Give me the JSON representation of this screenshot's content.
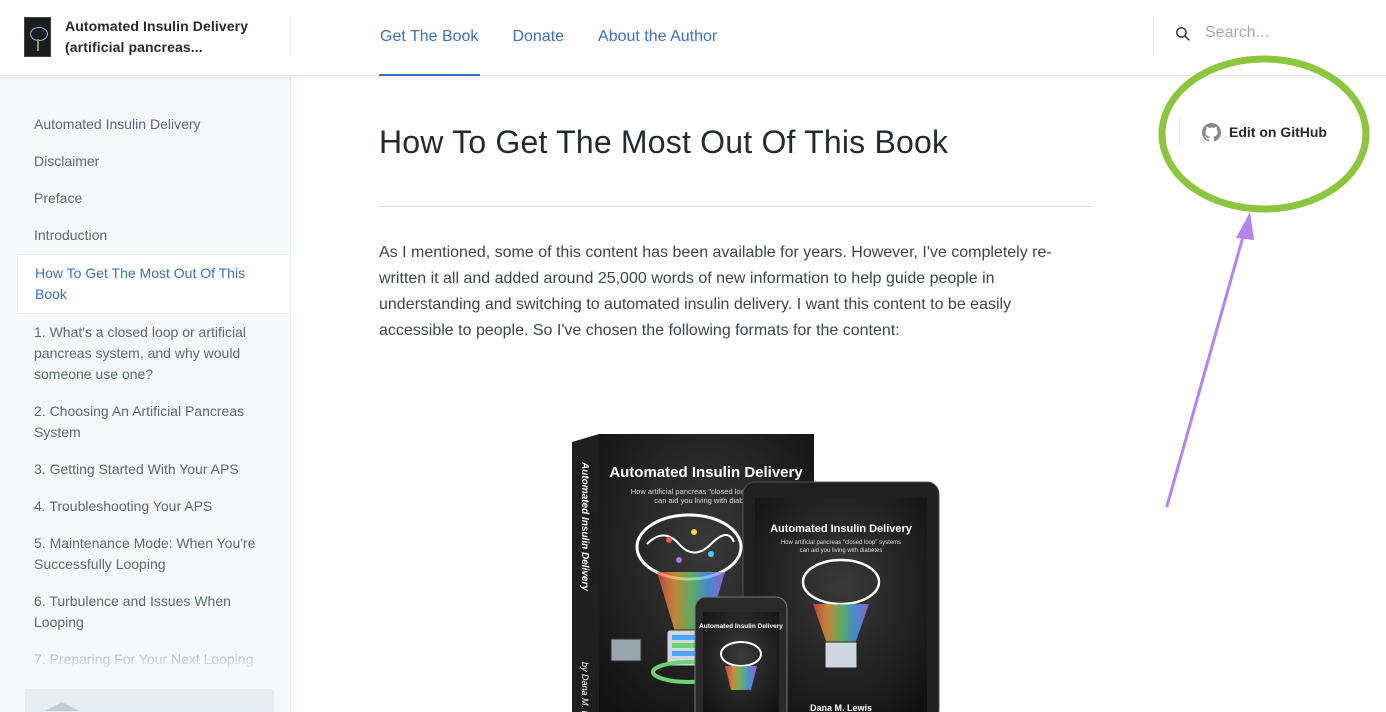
{
  "header": {
    "brand_title": "Automated Insulin Delivery (artificial pancreas...",
    "nav": [
      {
        "label": "Get The Book",
        "active": true
      },
      {
        "label": "Donate",
        "active": false
      },
      {
        "label": "About the Author",
        "active": false
      }
    ],
    "search_placeholder": "Search..."
  },
  "sidebar": {
    "items": [
      {
        "label": "Automated Insulin Delivery"
      },
      {
        "label": "Disclaimer"
      },
      {
        "label": "Preface"
      },
      {
        "label": "Introduction"
      },
      {
        "label": "How To Get The Most Out Of This Book",
        "active": true
      },
      {
        "label": "1. What's a closed loop or artificial pancreas system, and why would someone use one?"
      },
      {
        "label": "2. Choosing An Artificial Pancreas System"
      },
      {
        "label": "3. Getting Started With Your APS"
      },
      {
        "label": "4. Troubleshooting Your APS"
      },
      {
        "label": "5. Maintenance Mode: When You're Successfully Looping"
      },
      {
        "label": "6. Turbulence and Issues When Looping"
      },
      {
        "label": "7. Preparing For Your Next Looping"
      }
    ]
  },
  "main": {
    "title": "How To Get The Most Out Of This Book",
    "intro": "As I mentioned, some of this content has been available for years. However, I've completely re-written it all and added around 25,000 words of new information to help guide people in understanding and switching to automated insulin delivery. I want this content to be easily accessible to people. So I've chosen the following formats for the content:",
    "image": {
      "print_title": "Automated Insulin Delivery",
      "print_subtitle_line1": "How artificial pancreas \"closed loop\" systems",
      "print_subtitle_line2": "can aid you living with diabetes",
      "spine": "Automated Insulin Delivery",
      "spine_author": "by Dana M. L",
      "tablet_title": "Automated Insulin Delivery",
      "tablet_subtitle_line1": "How artificial pancreas \"closed loop\" systems",
      "tablet_subtitle_line2": "can aid you living with diabetes",
      "phone_title": "Automated Insulin Delivery",
      "author": "Dana M. Lewis"
    }
  },
  "edit_github_label": "Edit on GitHub",
  "colors": {
    "accent": "#3a6fc2",
    "annotation_circle": "#8cc63f",
    "annotation_arrow": "#b483ee"
  }
}
